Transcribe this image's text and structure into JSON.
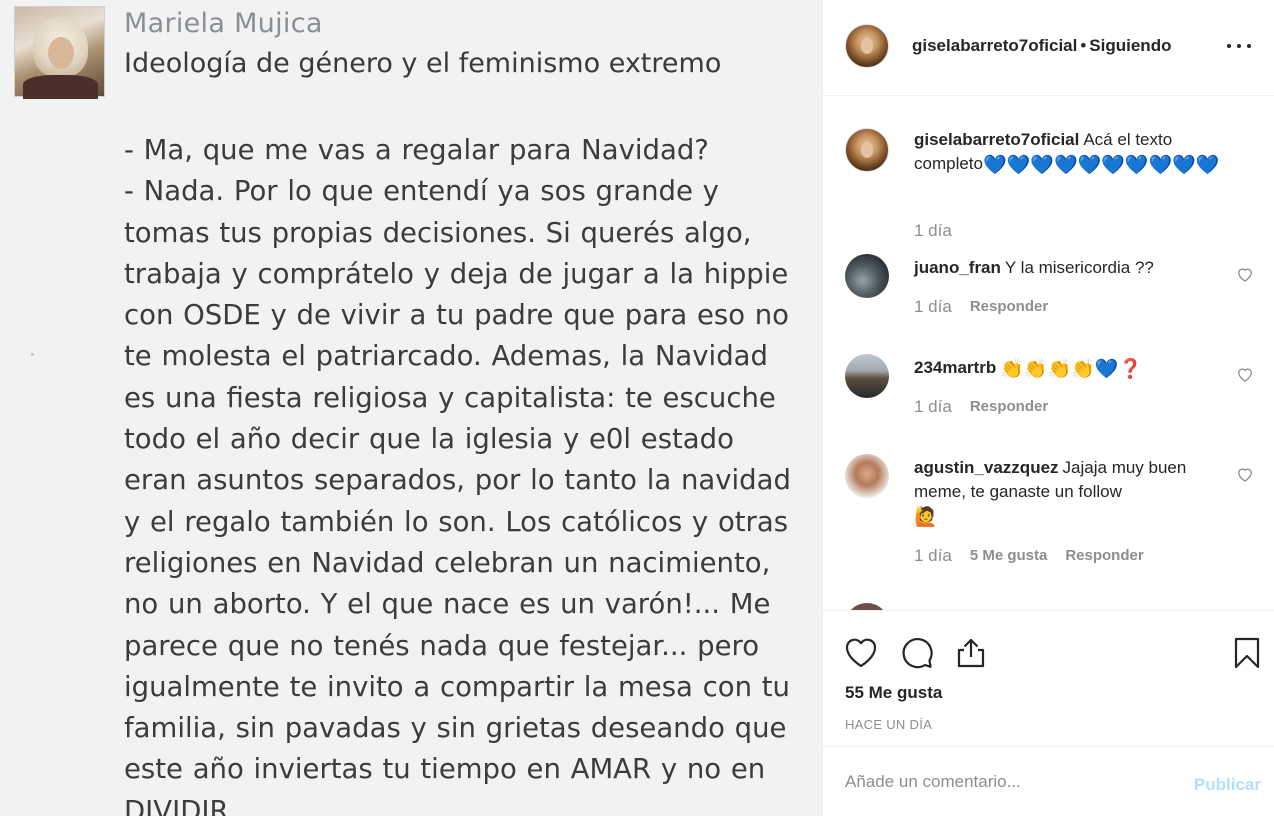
{
  "post_image": {
    "author": "Mariela Mujica",
    "title": "Ideología de género y el feminismo extremo",
    "body": "- Ma, que me vas a regalar para Navidad?\n- Nada. Por lo que entendí ya sos grande y\ntomas tus propias decisiones. Si querés algo,\ntrabaja y comprátelo y deja de jugar a la hippie\ncon OSDE y de vivir a tu padre que para eso no\nte molesta el patriarcado. Ademas, la Navidad\nes una fiesta religiosa y capitalista: te escuche\ntodo el año decir que la iglesia y e0l estado\neran asuntos separados, por lo tanto la navidad\ny el regalo también lo son. Los católicos y otras\nreligiones en Navidad celebran un nacimiento,\nno un aborto. Y el que nace es un varón!... Me\nparece que no tenés nada que festejar... pero\nigualmente te invito a compartir la mesa con tu\nfamilia, sin pavadas y sin grietas deseando que\neste año inviertas tu tiempo en AMAR y no en\nDIVIDIR......"
  },
  "header": {
    "username": "giselabarreto7oficial",
    "separator": "•",
    "follow_status": "Siguiendo",
    "more_icon": "more-options-icon"
  },
  "caption": {
    "username": "giselabarreto7oficial",
    "text": "Acá el texto completo",
    "emojis": "💙💙💙💙💙💙💙💙💙💙",
    "time": "1 día"
  },
  "comments": [
    {
      "username": "juano_fran",
      "text": "Y la misericordia ??",
      "emojis": "",
      "time": "1 día",
      "likes": "",
      "reply": "Responder"
    },
    {
      "username": "234martrb",
      "text": "",
      "emojis": "👏👏👏👏💙❓",
      "time": "1 día",
      "likes": "",
      "reply": "Responder"
    },
    {
      "username": "agustin_vazzquez",
      "text": "Jajaja muy buen meme, te ganaste un follow",
      "emojis": "🙋",
      "time": "1 día",
      "likes": "5 Me gusta",
      "reply": "Responder"
    }
  ],
  "actions": {
    "like_icon": "heart-icon",
    "comment_icon": "comment-icon",
    "share_icon": "share-icon",
    "save_icon": "bookmark-icon",
    "likes": "55 Me gusta",
    "posted": "HACE UN DÍA"
  },
  "add_comment": {
    "placeholder": "Añade un comentario...",
    "publish": "Publicar"
  },
  "colors": {
    "text": "#262626",
    "muted": "#8e8e8e",
    "publish_disabled": "#b2dffc",
    "divider": "#efefef"
  }
}
